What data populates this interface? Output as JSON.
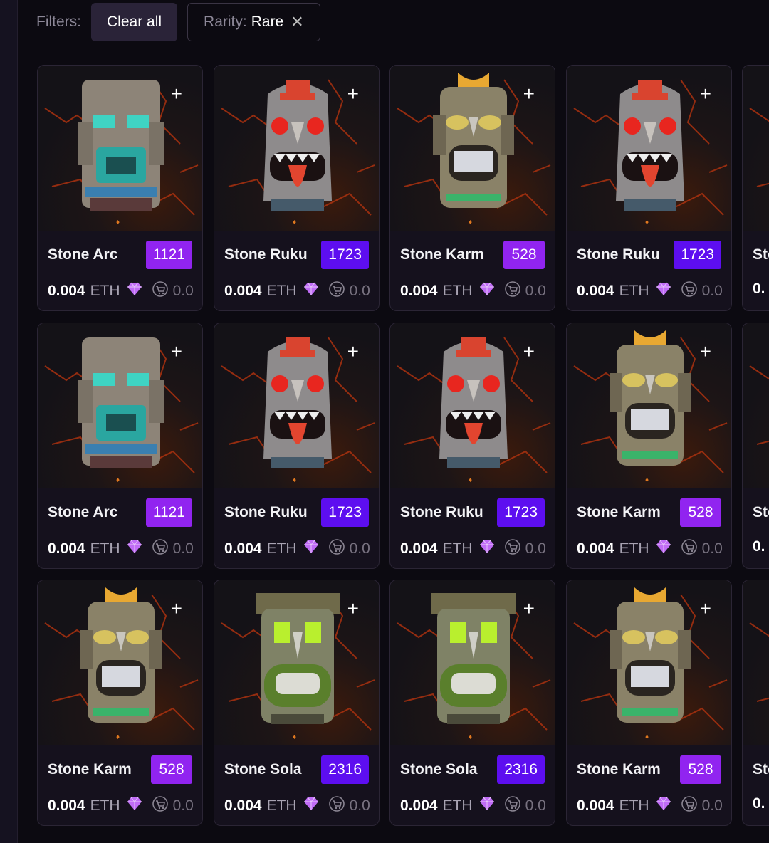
{
  "filters": {
    "label": "Filters:",
    "clear_all": "Clear all",
    "chip_key": "Rarity:",
    "chip_value": "Rare",
    "chip_remove": "✕"
  },
  "colors": {
    "badge_purple": "#9124f0",
    "badge_indigo": "#5d0ef0",
    "gem": "#c06cf6"
  },
  "cards": [
    {
      "name": "Stone Arc",
      "id": "1121",
      "price": "0.004",
      "currency": "ETH",
      "fee": "0.0",
      "totem": "arc",
      "badge": "purple"
    },
    {
      "name": "Stone Ruku",
      "id": "1723",
      "price": "0.004",
      "currency": "ETH",
      "fee": "0.0",
      "totem": "ruku",
      "badge": "indigo"
    },
    {
      "name": "Stone Karm",
      "id": "528",
      "price": "0.004",
      "currency": "ETH",
      "fee": "0.0",
      "totem": "karm",
      "badge": "purple"
    },
    {
      "name": "Stone Ruku",
      "id": "1723",
      "price": "0.004",
      "currency": "ETH",
      "fee": "0.0",
      "totem": "ruku",
      "badge": "indigo"
    },
    {
      "name": "Sto",
      "id": "",
      "price": "0.",
      "currency": "",
      "fee": "",
      "totem": "arc",
      "badge": "none"
    },
    {
      "name": "Stone Arc",
      "id": "1121",
      "price": "0.004",
      "currency": "ETH",
      "fee": "0.0",
      "totem": "arc",
      "badge": "purple"
    },
    {
      "name": "Stone Ruku",
      "id": "1723",
      "price": "0.004",
      "currency": "ETH",
      "fee": "0.0",
      "totem": "ruku",
      "badge": "indigo"
    },
    {
      "name": "Stone Ruku",
      "id": "1723",
      "price": "0.004",
      "currency": "ETH",
      "fee": "0.0",
      "totem": "ruku",
      "badge": "indigo"
    },
    {
      "name": "Stone Karm",
      "id": "528",
      "price": "0.004",
      "currency": "ETH",
      "fee": "0.0",
      "totem": "karm",
      "badge": "purple"
    },
    {
      "name": "Sto",
      "id": "",
      "price": "0.",
      "currency": "",
      "fee": "",
      "totem": "arc",
      "badge": "none"
    },
    {
      "name": "Stone Karm",
      "id": "528",
      "price": "0.004",
      "currency": "ETH",
      "fee": "0.0",
      "totem": "karm",
      "badge": "purple"
    },
    {
      "name": "Stone Sola",
      "id": "2316",
      "price": "0.004",
      "currency": "ETH",
      "fee": "0.0",
      "totem": "sola",
      "badge": "indigo"
    },
    {
      "name": "Stone Sola",
      "id": "2316",
      "price": "0.004",
      "currency": "ETH",
      "fee": "0.0",
      "totem": "sola",
      "badge": "indigo"
    },
    {
      "name": "Stone Karm",
      "id": "528",
      "price": "0.004",
      "currency": "ETH",
      "fee": "0.0",
      "totem": "karm",
      "badge": "purple"
    },
    {
      "name": "Sto",
      "id": "",
      "price": "0.",
      "currency": "",
      "fee": "",
      "totem": "arc",
      "badge": "none"
    }
  ]
}
